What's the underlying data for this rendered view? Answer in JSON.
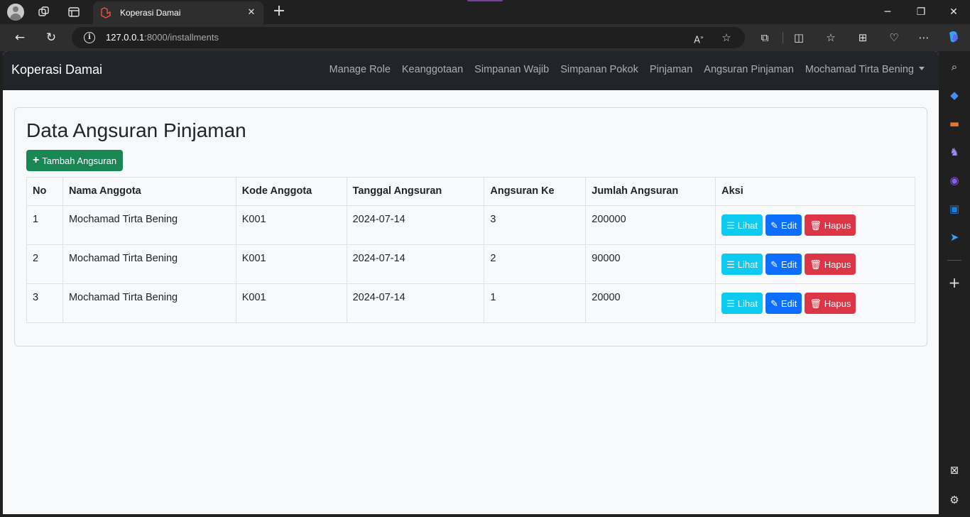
{
  "browser": {
    "tab_title": "Koperasi Damai",
    "url_host": "127.0.0.1",
    "url_rest": ":8000/installments",
    "accent_color": "#7b3fa0"
  },
  "navbar": {
    "brand": "Koperasi Damai",
    "links": [
      "Manage Role",
      "Keanggotaan",
      "Simpanan Wajib",
      "Simpanan Pokok",
      "Pinjaman",
      "Angsuran Pinjaman"
    ],
    "user_menu": "Mochamad Tirta Bening"
  },
  "page": {
    "title": "Data Angsuran Pinjaman",
    "add_button": "Tambah Angsuran"
  },
  "table": {
    "headers": [
      "No",
      "Nama Anggota",
      "Kode Anggota",
      "Tanggal Angsuran",
      "Angsuran Ke",
      "Jumlah Angsuran",
      "Aksi"
    ],
    "rows": [
      [
        "1",
        "Mochamad Tirta Bening",
        "K001",
        "2024-07-14",
        "3",
        "200000"
      ],
      [
        "2",
        "Mochamad Tirta Bening",
        "K001",
        "2024-07-14",
        "2",
        "90000"
      ],
      [
        "3",
        "Mochamad Tirta Bening",
        "K001",
        "2024-07-14",
        "1",
        "20000"
      ]
    ],
    "actions": {
      "view": "Lihat",
      "edit": "Edit",
      "delete": "Hapus"
    }
  },
  "colors": {
    "navbar_bg": "#212529",
    "success": "#198754",
    "info": "#0dcaf0",
    "primary": "#0d6efd",
    "danger": "#dc3545"
  }
}
